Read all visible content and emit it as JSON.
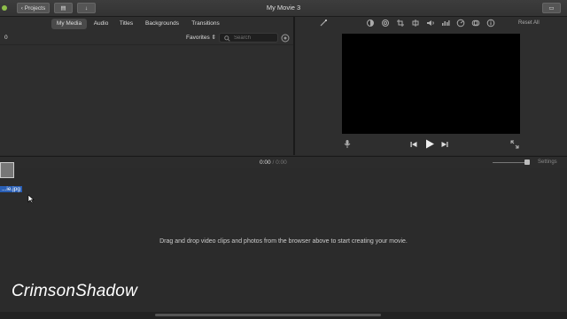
{
  "window": {
    "title": "My Movie 3",
    "projects_label": "Projects"
  },
  "browser": {
    "tabs": [
      "My Media",
      "Audio",
      "Titles",
      "Backgrounds",
      "Transitions"
    ],
    "active_tab": "My Media",
    "count": "0",
    "filter": "Favorites",
    "search_placeholder": "Search"
  },
  "viewer": {
    "reset_label": "Reset All"
  },
  "timeline": {
    "current_time": "0:00",
    "separator": "/",
    "total_time": "0:00",
    "settings_label": "Settings",
    "clip_name": "...ie.jpg",
    "hint": "Drag and drop video clips and photos from the browser above to start creating your movie."
  },
  "watermark": "CrimsonShadow",
  "colors": {
    "background": "#2a2a2a",
    "selection": "#2a5fb5",
    "preview": "#000000"
  }
}
